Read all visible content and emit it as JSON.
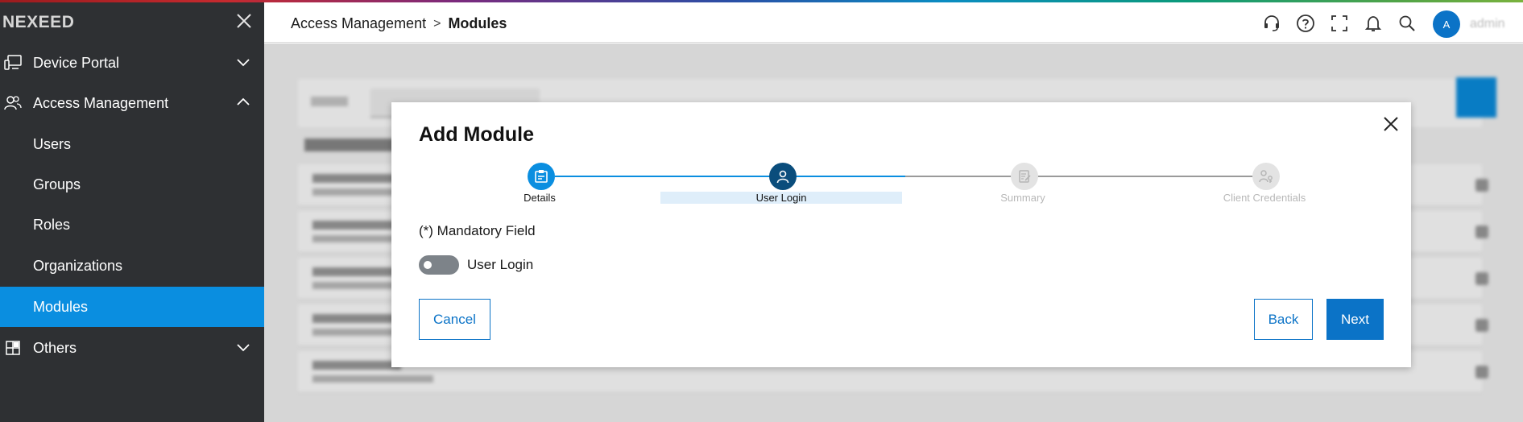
{
  "sidebar": {
    "brand": "NEXEED",
    "items": [
      {
        "label": "Device Portal"
      },
      {
        "label": "Access Management"
      },
      {
        "label": "Users"
      },
      {
        "label": "Groups"
      },
      {
        "label": "Roles"
      },
      {
        "label": "Organizations"
      },
      {
        "label": "Modules"
      },
      {
        "label": "Others"
      }
    ]
  },
  "header": {
    "breadcrumb_parent": "Access Management",
    "breadcrumb_separator": ">",
    "breadcrumb_current": "Modules",
    "icons": [
      "headset-icon",
      "help-icon",
      "fullscreen-icon",
      "bell-icon",
      "search-icon"
    ],
    "avatar_initial": "A",
    "username": "admin"
  },
  "modal": {
    "title": "Add Module",
    "steps": [
      {
        "label": "Details",
        "state": "completed"
      },
      {
        "label": "User Login",
        "state": "current"
      },
      {
        "label": "Summary",
        "state": "upcoming"
      },
      {
        "label": "Client Credentials",
        "state": "upcoming"
      }
    ],
    "mandatory_note": "(*) Mandatory Field",
    "toggle_label": "User Login",
    "toggle_on": false,
    "cancel_label": "Cancel",
    "back_label": "Back",
    "next_label": "Next"
  },
  "colors": {
    "sidebar_bg": "#2e3033",
    "accent": "#0a8ee0",
    "primary_button": "#0b73c7",
    "step_current": "#0a4d7c",
    "step_upcoming": "#c8c8c8"
  }
}
